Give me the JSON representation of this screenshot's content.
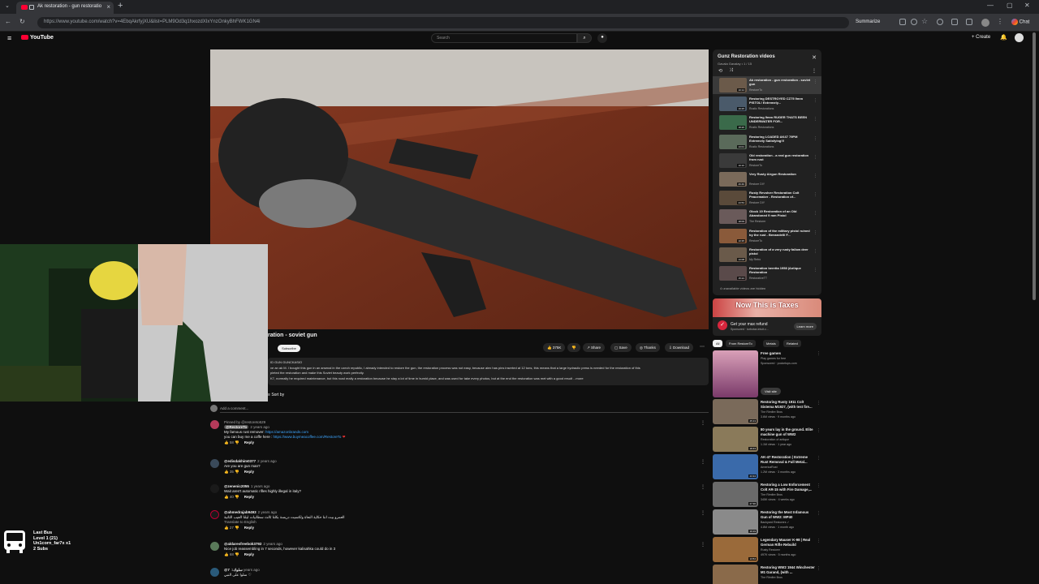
{
  "browser": {
    "tab_title": "Ak restoration - gun restoratio",
    "url": "https://www.youtube.com/watch?v=4EbqAkrfyjXU&list=PLM9Od3q1hxozdXIxYnzOnkyBhFWK1GN4i",
    "summarize_label": "Summarize",
    "chat_label": "Chat"
  },
  "youtube": {
    "logo_text": "YouTube",
    "search_placeholder": "Search",
    "create_label": "Create"
  },
  "video": {
    "title": "ration - soviet gun",
    "subscribe_label": "Subscribe",
    "like_count": "375K",
    "share_label": "Share",
    "save_label": "Save",
    "shorts_label": "Thanks",
    "download_label": "Download",
    "description_line1": "ID GUN GUNCKASIO",
    "description_line2": "ve an ak M. I bought this gun in an arsenal in the czech republic, I already intended to restore the gun, the restoration process was not easy, because alex has pins inserted at 12 tons, this means that a large hydraulic press is needed for the restoration of this",
    "description_line3": "pleted the restoration and make this Soviet beauty work perfectly.",
    "description_line4": "K7, normally he required maintenance, but this road really a restoration because he stay a lot of time in humid place, and was used for take every photos, but at the end the restoration was met with a good result  ...more",
    "sort_label": "Sort by",
    "add_comment": "Add a comment..."
  },
  "comments": [
    {
      "author": "@RestoreTo",
      "pinned": "Pinned by @restoreto529",
      "time": "2 years ago",
      "text1": "My famous rust remover: ",
      "link1": "https://amazonbrands.com",
      "text2": "you can buy me a coffe  here : ",
      "link2": "https://www.buymeacoffee.com/RestoreTo",
      "likes": "58",
      "reply": "Reply"
    },
    {
      "author": "@edisdakhim0377",
      "time": "2 years ago",
      "text1": "Are you are gun man?",
      "likes": "35",
      "reply": "Reply"
    },
    {
      "author": "@zenenic2055",
      "time": "1 years ago",
      "text1": "Wait aren't automatic rifles highly illegal in italy?",
      "likes": "40",
      "reply": "Reply"
    },
    {
      "author": "@ahmedrajab9493",
      "time": "2 years ago",
      "text1": "العمرو بيت اننا حكاية النعاة ولكسيت دريسة بكلنا ثالث سطانيات ليلنا العيب الثانية",
      "text2": "Translate to English",
      "likes": "27",
      "reply": "Reply"
    },
    {
      "author": "@aldaresfreebok3792",
      "time": "2 years ago",
      "text1": "Nice job reassembling in 7 seconds, however kalisahka could do in 3",
      "likes": "68",
      "reply": "Reply"
    },
    {
      "author": "@سلوك7",
      "time": "1 years ago",
      "text1": "سلوا على النبي ♡",
      "likes": "",
      "reply": ""
    }
  ],
  "playlist": {
    "title": "Gunz Restoration  videos",
    "subtitle": "Gavala Gavalay • 1 / 15",
    "hidden_note": "4 unavailable videos are hidden",
    "items": [
      {
        "title": "Ak restoration - gun restoration - soviet gun",
        "channel": "RestoreTo",
        "duration": "10:14",
        "color": "#6b5a4a"
      },
      {
        "title": "Restoring DESTROYED CZ75 9mm PISTOL! Extremely...",
        "channel": "Rustic Restorations",
        "duration": "19:25",
        "color": "#4a5a6a"
      },
      {
        "title": "Restoring 9mm RUGER THATS BEEN UNDERWATER FOR...",
        "channel": "Rustic Restorations",
        "duration": "18:26",
        "color": "#3a6a4a"
      },
      {
        "title": "Restoring LOADED AK47 79PM Extremely Satisfying!!!",
        "channel": "Rustic Restorations",
        "duration": "13:01",
        "color": "#5a6a5a"
      },
      {
        "title": "Old restoration - a real gun restoration from rust",
        "channel": "RestoreTo",
        "duration": "10:16",
        "color": "#3a3a3a"
      },
      {
        "title": "Very Rusty Airgun Restoration",
        "channel": "Restore DIY",
        "duration": "26:40",
        "color": "#7a6a5a"
      },
      {
        "title": "Rusty Revolver Restoration Colt Peacemaker - Restoration of...",
        "channel": "Restore DIY",
        "duration": "23:53",
        "color": "#5a4a3a"
      },
      {
        "title": "Glock 19 Restoration of an Old Abandoned 9 mm Pistol",
        "channel": "The Restorer",
        "duration": "18:09",
        "color": "#6a5a5a"
      },
      {
        "title": "Restoration of the military pistol ruined by the rust - Benandelli F...",
        "channel": "RestoreTo",
        "duration": "10:35",
        "color": "#8a5a3a"
      },
      {
        "title": "Restoration of a very rusty fallow deer pistol",
        "channel": "My Retro",
        "duration": "13:08",
        "color": "#6a5a4a"
      },
      {
        "title": "Restoration beretta 1958 |Antique Restoration",
        "channel": "RestorativeTT",
        "duration": "15:24",
        "color": "#5a4a4a"
      }
    ]
  },
  "ad": {
    "headline": "Now This is Taxes",
    "title": "Get your max refund",
    "sponsor": "Sponsored · turbotax.intuit.c...",
    "button": "Learn more"
  },
  "chips": [
    "All",
    "From RestoreTo",
    "Metals",
    "Related"
  ],
  "rec_ad": {
    "title": "Free games",
    "desc": "Play games for free",
    "sponsor": "Sponsored · pocketops.com",
    "button": "Visit site"
  },
  "recommendations": [
    {
      "title": "Restoring Rusty 1911 Colt Sistema M1927, (with test fire...",
      "channel": "The Rimfire Bros",
      "views": "3.6M views · 9 months ago",
      "duration": "25:13",
      "color": "#7a6a5a"
    },
    {
      "title": "80 years lay in the ground. Elite machine gun of WW2",
      "channel": "Restoration of antique",
      "views": "1.1M views · 1 year ago",
      "duration": "18:43",
      "color": "#8a7a5a"
    },
    {
      "title": "AK-47 Restoration | Extreme Rust Removal & Full Metal...",
      "channel": "AmericaRust",
      "views": "1.2M views · 3 months ago",
      "duration": "23:34",
      "color": "#3a6aaa"
    },
    {
      "title": "Restoring a Low Enforcement Colt AR-15 with Fire Damage,...",
      "channel": "The Rimfire Bros",
      "views": "345K views · 4 weeks ago",
      "duration": "27:36",
      "color": "#6a6a6a"
    },
    {
      "title": "Restoring the Most Infamous Gun of WW2: MP40",
      "channel": "Backyard Restorers ✓",
      "views": "4.8M views · 1 month ago",
      "duration": "19:19",
      "color": "#8a8a8a"
    },
    {
      "title": "Legendary Mauser K-98 | Real German Rifle Rebuild",
      "channel": "Rusty Restorer",
      "views": "497K views · 5 months ago",
      "duration": "13:54",
      "color": "#9a6a3a"
    },
    {
      "title": "Restoring WW2 1944 Winchester M1 Garand, (with ...",
      "channel": "The Rimfire Bros",
      "views": "",
      "duration": "",
      "color": "#8a6a4a"
    }
  ],
  "overlay": {
    "line1": "Last Bus",
    "line2": "Level  1  (21)",
    "line3": "Un1corn_far7x x1",
    "line4": "2 Subs"
  }
}
